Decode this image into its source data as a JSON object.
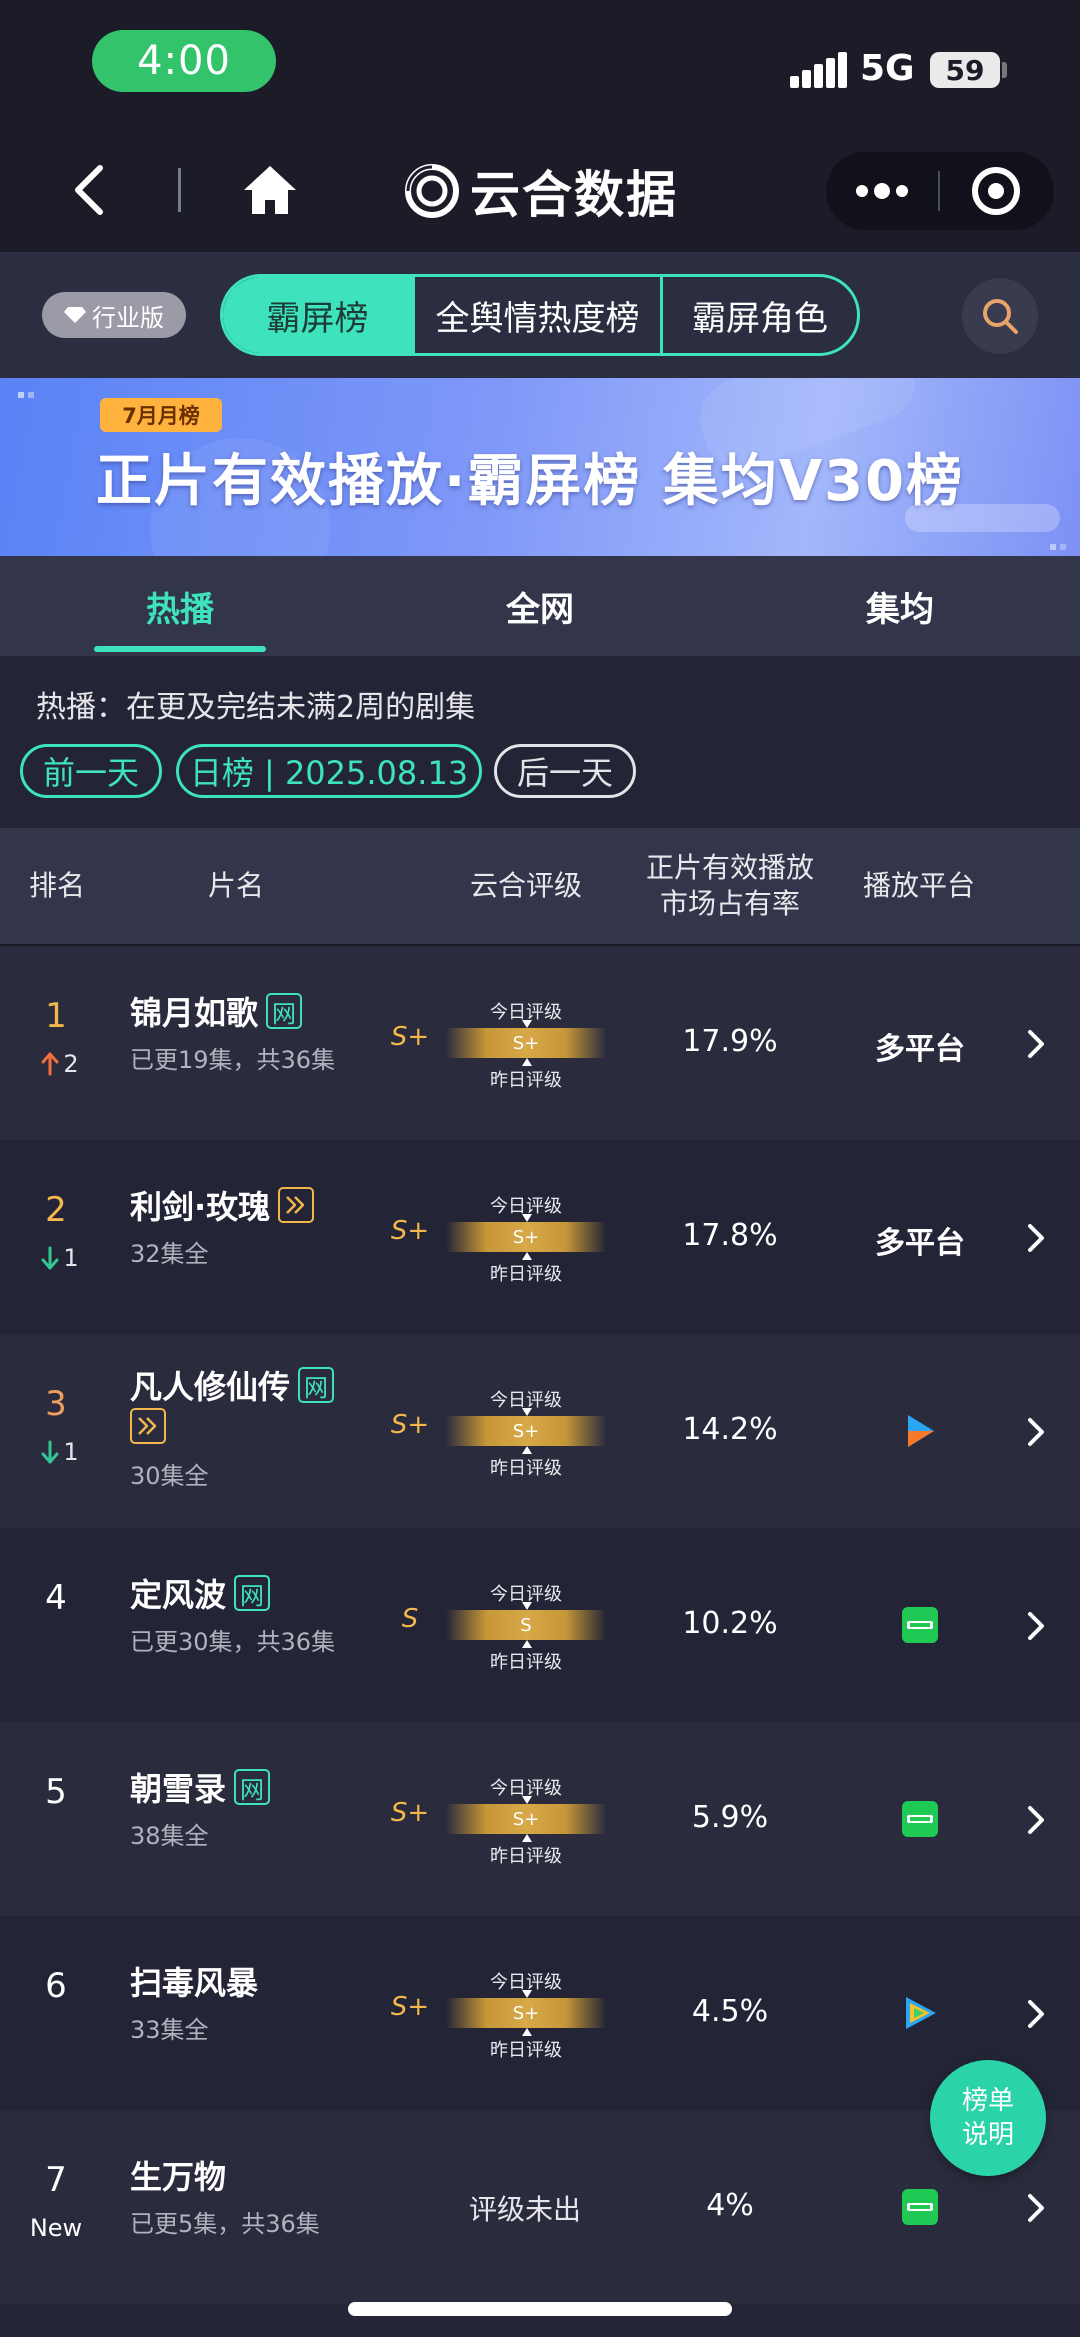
{
  "status_bar": {
    "time": "4:00",
    "network": "5G",
    "battery": "59"
  },
  "nav": {
    "title": "云合数据"
  },
  "segment": {
    "edition_badge": "行业版",
    "items": [
      "霸屏榜",
      "全舆情热度榜",
      "霸屏角色"
    ],
    "active_index": 0
  },
  "banner": {
    "tag": "7月月榜",
    "title": "正片有效播放·霸屏榜 集均V30榜"
  },
  "tabs": {
    "items": [
      "热播",
      "全网",
      "集均"
    ],
    "active_index": 0
  },
  "filter": {
    "description": "热播：在更及完结未满2周的剧集",
    "prev_day": "前一天",
    "current": "日榜 | 2025.08.13",
    "next_day": "后一天"
  },
  "table": {
    "headers": {
      "rank": "排名",
      "title": "片名",
      "rating": "云合评级",
      "share_line1": "正片有效播放",
      "share_line2": "市场占有率",
      "platform": "播放平台"
    },
    "grade_labels": {
      "today": "今日评级",
      "yesterday": "昨日评级"
    },
    "rows": [
      {
        "rank": "1",
        "delta_dir": "up",
        "delta": "2",
        "title": "锦月如歌",
        "badges": [
          "网"
        ],
        "subtitle": "已更19集，共36集",
        "rating": "S+",
        "share": "17.9%",
        "platform_text": "多平台",
        "platform_icon": ""
      },
      {
        "rank": "2",
        "delta_dir": "down",
        "delta": "1",
        "title": "利剑·玫瑰",
        "badges": [
          "play"
        ],
        "subtitle": "32集全",
        "rating": "S+",
        "share": "17.8%",
        "platform_text": "多平台",
        "platform_icon": ""
      },
      {
        "rank": "3",
        "delta_dir": "down",
        "delta": "1",
        "title": "凡人修仙传",
        "badges": [
          "网",
          "play"
        ],
        "subtitle": "30集全",
        "rating": "S+",
        "share": "14.2%",
        "platform_text": "",
        "platform_icon": "youku-icon"
      },
      {
        "rank": "4",
        "delta_dir": "",
        "delta": "",
        "title": "定风波",
        "badges": [
          "网"
        ],
        "subtitle": "已更30集，共36集",
        "rating": "S",
        "share": "10.2%",
        "platform_text": "",
        "platform_icon": "iqiyi-icon"
      },
      {
        "rank": "5",
        "delta_dir": "",
        "delta": "",
        "title": "朝雪录",
        "badges": [
          "网"
        ],
        "subtitle": "38集全",
        "rating": "S+",
        "share": "5.9%",
        "platform_text": "",
        "platform_icon": "iqiyi-icon"
      },
      {
        "rank": "6",
        "delta_dir": "",
        "delta": "",
        "title": "扫毒风暴",
        "badges": [],
        "subtitle": "33集全",
        "rating": "S+",
        "share": "4.5%",
        "platform_text": "",
        "platform_icon": "tencent-video-icon"
      },
      {
        "rank": "7",
        "delta_dir": "new",
        "delta": "New",
        "title": "生万物",
        "badges": [],
        "subtitle": "已更5集，共36集",
        "rating": "评级未出",
        "share": "4%",
        "platform_text": "",
        "platform_icon": "iqiyi-icon"
      }
    ]
  },
  "float_button": {
    "line1": "榜单",
    "line2": "说明"
  },
  "colors": {
    "accent": "#3ee3bd",
    "gold": "#f3b74c",
    "up": "#f46f3b",
    "down": "#33c592",
    "bg": "#232536"
  }
}
